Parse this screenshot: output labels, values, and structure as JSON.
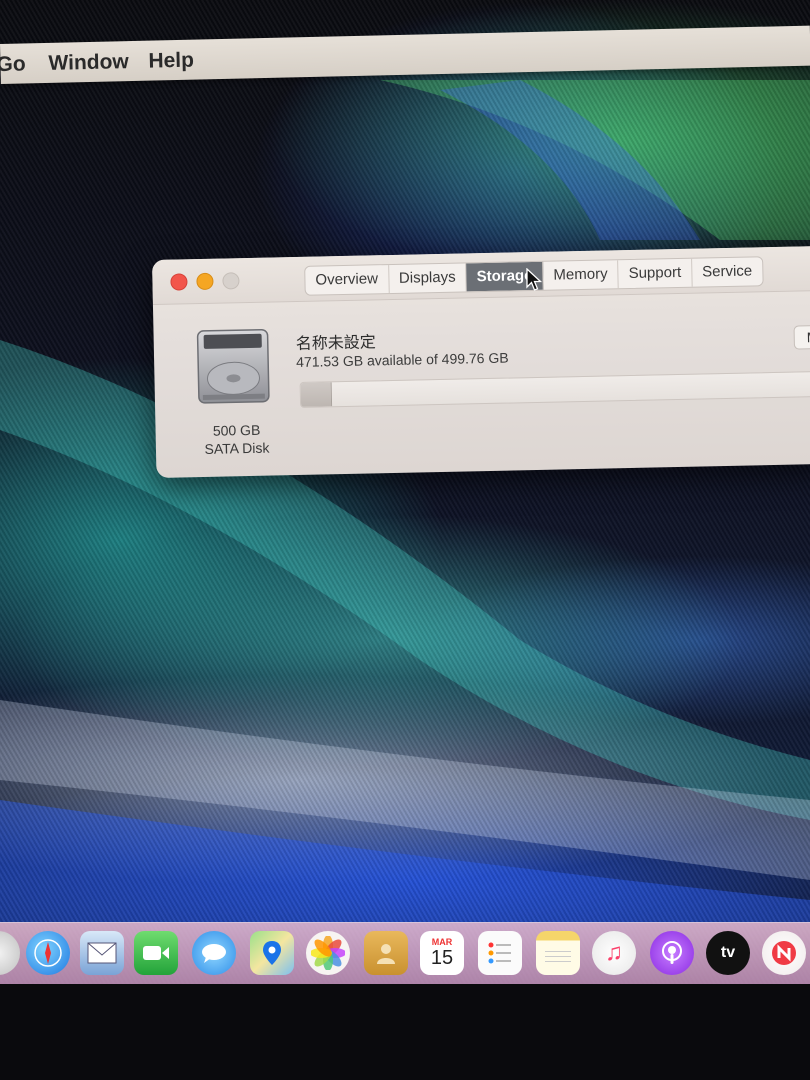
{
  "menubar": {
    "items": [
      "Go",
      "Window",
      "Help"
    ]
  },
  "window": {
    "tabs": [
      {
        "label": "Overview",
        "active": false
      },
      {
        "label": "Displays",
        "active": false
      },
      {
        "label": "Storage",
        "active": true
      },
      {
        "label": "Memory",
        "active": false
      },
      {
        "label": "Support",
        "active": false
      },
      {
        "label": "Service",
        "active": false
      }
    ],
    "disk": {
      "size_label": "500 GB",
      "type_label": "SATA Disk",
      "volume_name": "名称未設定",
      "availability": "471.53 GB available of 499.76 GB",
      "used_fraction": 0.056
    },
    "right_button_label": "M"
  },
  "dock": {
    "icons": [
      "launchpad-icon",
      "safari-icon",
      "mail-icon",
      "facetime-icon",
      "messages-icon",
      "maps-icon",
      "photos-icon",
      "contacts-icon",
      "calendar-icon",
      "reminders-icon",
      "notes-icon",
      "music-icon",
      "podcasts-icon",
      "apple-tv-icon",
      "news-icon"
    ],
    "calendar_month": "MAR",
    "calendar_day": "15",
    "tv_label": "tv"
  },
  "colors": {
    "active_tab": "#6b6f75",
    "close": "#f2554b",
    "minimize": "#f5a623"
  }
}
